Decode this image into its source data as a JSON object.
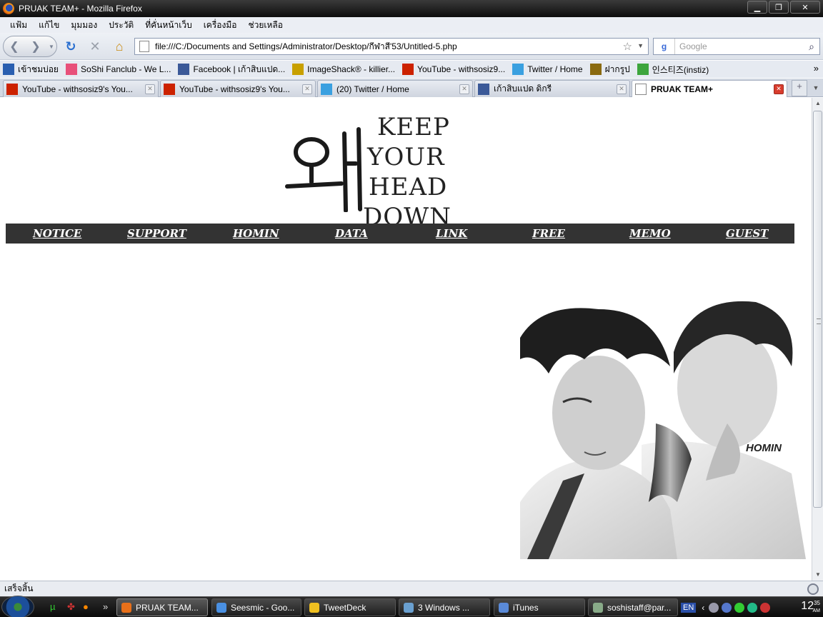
{
  "window": {
    "title": "PRUAK TEAM+ - Mozilla Firefox",
    "controls": {
      "minimize": "▁",
      "maximize": "❐",
      "close": "✕"
    }
  },
  "menu": [
    "แฟ้ม",
    "แก้ไข",
    "มุมมอง",
    "ประวัติ",
    "ที่คั่นหน้าเว็บ",
    "เครื่องมือ",
    "ช่วยเหลือ"
  ],
  "toolbar": {
    "url": "file:///C:/Documents and Settings/Administrator/Desktop/กีฬาสี'53/Untitled-5.php",
    "search_placeholder": "Google",
    "search_engine_letter": "g"
  },
  "bookmarks": [
    {
      "label": "เข้าชมบ่อย",
      "icon": "most-visited-icon",
      "color": "#2a5fb0"
    },
    {
      "label": "SoShi Fanclub - We L...",
      "icon": "soshi-icon",
      "color": "#e8507a"
    },
    {
      "label": "Facebook | เก้าสิบแปด...",
      "icon": "facebook-icon",
      "color": "#3b5998"
    },
    {
      "label": "ImageShack® - killier...",
      "icon": "imageshack-icon",
      "color": "#c8a000"
    },
    {
      "label": "YouTube - withsosiz9...",
      "icon": "youtube-icon",
      "color": "#cc2200"
    },
    {
      "label": "Twitter / Home",
      "icon": "twitter-icon",
      "color": "#3aa0e0"
    },
    {
      "label": "ฝากรูป",
      "icon": "photo-host-icon",
      "color": "#8a6a10"
    },
    {
      "label": "인스티즈(instiz)",
      "icon": "instiz-icon",
      "color": "#3da53d"
    }
  ],
  "tabs": [
    {
      "label": "YouTube - withsosiz9's You...",
      "icon": "youtube-icon",
      "color": "#cc2200"
    },
    {
      "label": "YouTube - withsosiz9's You...",
      "icon": "youtube-icon",
      "color": "#cc2200"
    },
    {
      "label": "(20) Twitter / Home",
      "icon": "twitter-icon",
      "color": "#3aa0e0"
    },
    {
      "label": "เก้าสิบแปด ดิกรี",
      "icon": "facebook-icon",
      "color": "#3b5998"
    },
    {
      "label": "PRUAK TEAM+",
      "icon": "page-icon",
      "color": "#ffffff",
      "active": true
    }
  ],
  "page": {
    "logo_words": [
      "KEEP",
      "YOUR",
      "HEAD",
      "DOWN"
    ],
    "nav": [
      "NOTICE",
      "SUPPORT",
      "HOMIN",
      "DATA",
      "LINK",
      "FREE",
      "MEMO",
      "GUEST"
    ],
    "photo_caption": "HOMIN"
  },
  "status": {
    "text": "เสร็จสิ้น"
  },
  "taskbar": {
    "tasks": [
      {
        "label": "PRUAK TEAM...",
        "color": "#e8701a",
        "active": true
      },
      {
        "label": "Seesmic - Goo...",
        "color": "#4a90e2"
      },
      {
        "label": "TweetDeck",
        "color": "#f0c020"
      },
      {
        "label": "3 Windows ...",
        "color": "#6aa0d0"
      },
      {
        "label": "iTunes",
        "color": "#5a8ad8"
      },
      {
        "label": "soshistaff@par...",
        "color": "#88aa88"
      }
    ],
    "lang": "EN",
    "clock": "12",
    "clock_minutes": "35",
    "ampm": "AM"
  }
}
